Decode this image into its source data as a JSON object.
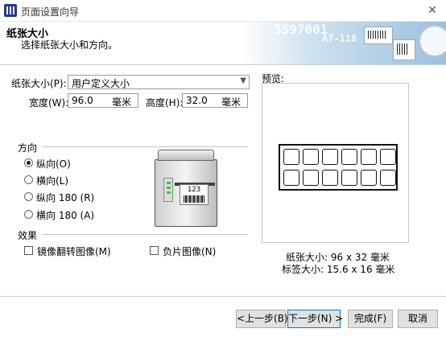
{
  "window": {
    "title": "页面设置向导",
    "close_glyph": "✕"
  },
  "header": {
    "title": "纸张大小",
    "subtitle": "选择纸张大小和方向。",
    "art_text_1": "3597001",
    "art_text_2": "A7-118"
  },
  "paper": {
    "label": "纸张大小(P):",
    "selected": "用户定义大小",
    "width_label": "宽度(W):",
    "width_value": "96.0",
    "width_unit": "毫米",
    "height_label": "高度(H):",
    "height_value": "32.0",
    "height_unit": "毫米"
  },
  "orientation": {
    "section_label": "方向",
    "options": [
      {
        "label": "纵向(O)",
        "selected": true
      },
      {
        "label": "横向(L)",
        "selected": false
      },
      {
        "label": "纵向 180 (R)",
        "selected": false
      },
      {
        "label": "横向 180 (A)",
        "selected": false
      }
    ]
  },
  "effects": {
    "section_label": "效果",
    "mirror_label": "镜像翻转图像(M)",
    "mirror_checked": false,
    "negative_label": "负片图像(N)",
    "negative_checked": false
  },
  "printer_label_text": "123",
  "preview": {
    "label": "预览:",
    "rows": 2,
    "cols": 6,
    "paper_size": "纸张大小:  96 x 32  毫米",
    "label_size": "标签大小:  15.6 x 16  毫米"
  },
  "buttons": {
    "back": "<上一步(B)",
    "next": "下一步(N) >",
    "finish": "完成(F)",
    "cancel": "取消"
  },
  "colors": {
    "accent": "#0078d7",
    "header_art": "#9cc0dc"
  }
}
